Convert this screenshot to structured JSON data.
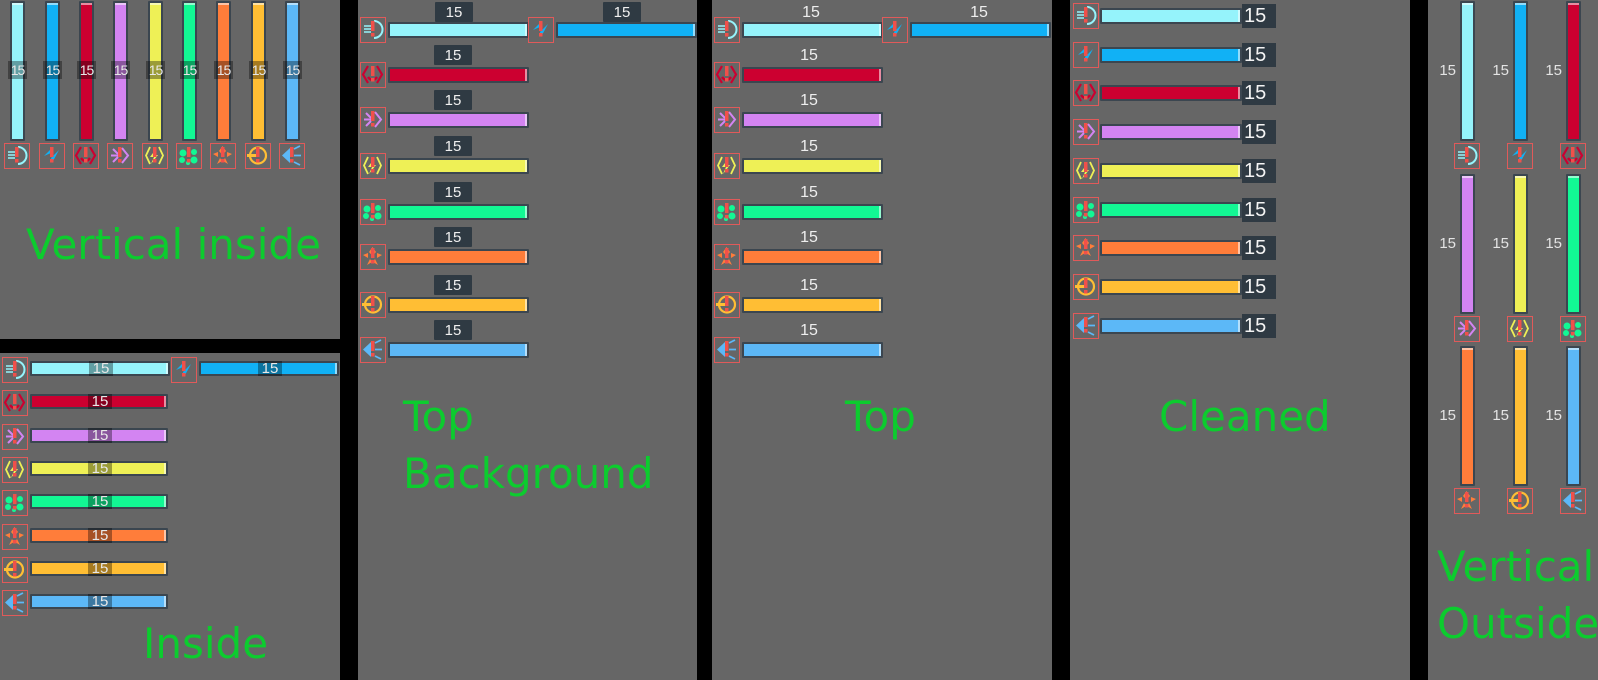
{
  "stat_value": "15",
  "stats": [
    {
      "key": "cold",
      "icon": "cold-hand-icon",
      "color": "#95f3fb"
    },
    {
      "key": "electric",
      "icon": "lightning-slash-icon",
      "color": "#11b1f5"
    },
    {
      "key": "impact",
      "icon": "hexagon-shield-icon",
      "color": "#cc0030"
    },
    {
      "key": "arcane",
      "icon": "crosshair-arrows-icon",
      "color": "#d384f2"
    },
    {
      "key": "shock",
      "icon": "hexagon-bolt-icon",
      "color": "#eef056"
    },
    {
      "key": "poison",
      "icon": "toxic-cloud-icon",
      "color": "#12f894"
    },
    {
      "key": "fire",
      "icon": "burst-icon",
      "color": "#ff7d3a"
    },
    {
      "key": "radiation",
      "icon": "circle-target-icon",
      "color": "#ffbe34"
    },
    {
      "key": "sonic",
      "icon": "spike-arrow-icon",
      "color": "#5cb8f7"
    }
  ],
  "panels": {
    "vertical_inside": {
      "caption": "Vertical inside"
    },
    "inside": {
      "caption": "Inside"
    },
    "top_background": {
      "caption": "Top\nBackground"
    },
    "top": {
      "caption": "Top"
    },
    "cleaned": {
      "caption": "Cleaned"
    },
    "vertical_outside": {
      "caption": "Vertical\nOutside"
    }
  },
  "accent": {
    "caption_color": "#0ccc2e",
    "icon_frame_color": "#e05a5a",
    "background": "#666666"
  }
}
